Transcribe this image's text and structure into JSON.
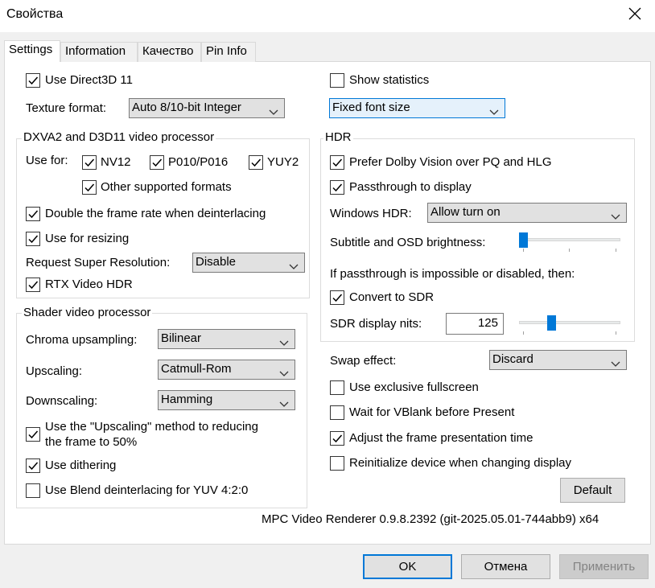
{
  "window": {
    "title": "Свойства"
  },
  "tabs": [
    "Settings",
    "Information",
    "Качество",
    "Pin Info"
  ],
  "left": {
    "use_d3d11": {
      "label": "Use Direct3D 11",
      "checked": true
    },
    "texture_format": {
      "label": "Texture format:",
      "value": "Auto 8/10-bit Integer"
    },
    "dxva_group": {
      "title": "DXVA2 and D3D11 video processor",
      "use_for_label": "Use for:",
      "nv12": {
        "label": "NV12",
        "checked": true
      },
      "p010": {
        "label": "P010/P016",
        "checked": true
      },
      "yuy2": {
        "label": "YUY2",
        "checked": true
      },
      "other": {
        "label": "Other supported formats",
        "checked": true
      },
      "double_rate": {
        "label": "Double the frame rate when deinterlacing",
        "checked": true
      },
      "resizing": {
        "label": "Use for resizing",
        "checked": true
      },
      "super_res_label": "Request Super Resolution:",
      "super_res_value": "Disable",
      "rtx_hdr": {
        "label": "RTX Video HDR",
        "checked": true
      }
    },
    "shader_group": {
      "title": "Shader video processor",
      "chroma_label": "Chroma upsampling:",
      "chroma_value": "Bilinear",
      "upscaling_label": "Upscaling:",
      "upscaling_value": "Catmull-Rom",
      "downscaling_label": "Downscaling:",
      "downscaling_value": "Hamming",
      "upscale_method": {
        "label_line1": "Use the \"Upscaling\" method to reducing",
        "label_line2": "the frame to 50%",
        "checked": true
      },
      "dithering": {
        "label": "Use dithering",
        "checked": true
      },
      "blend": {
        "label": "Use Blend deinterlacing for YUV 4:2:0",
        "checked": false
      }
    }
  },
  "right": {
    "show_stats": {
      "label": "Show statistics",
      "checked": false
    },
    "font_size_value": "Fixed font size",
    "hdr_group": {
      "title": "HDR",
      "dolby": {
        "label": "Prefer Dolby Vision over PQ and HLG",
        "checked": true
      },
      "passthrough": {
        "label": "Passthrough to display",
        "checked": true
      },
      "windows_hdr_label": "Windows HDR:",
      "windows_hdr_value": "Allow turn on",
      "osd_label": "Subtitle and OSD brightness:",
      "osd_level": 0,
      "if_passthrough": "If passthrough is impossible or disabled, then:",
      "convert_sdr": {
        "label": "Convert to SDR",
        "checked": true
      },
      "nits_label": "SDR display nits:",
      "nits_value": "125",
      "nits_level": 0.3
    },
    "swap_label": "Swap effect:",
    "swap_value": "Discard",
    "exclusive": {
      "label": "Use exclusive fullscreen",
      "checked": false
    },
    "vblank": {
      "label": "Wait for VBlank before Present",
      "checked": false
    },
    "adjust_time": {
      "label": "Adjust the frame presentation time",
      "checked": true
    },
    "reinit": {
      "label": "Reinitialize device when changing display",
      "checked": false
    },
    "default_button": "Default"
  },
  "version": "MPC Video Renderer 0.9.8.2392 (git-2025.05.01-744abb9) x64",
  "buttons": {
    "ok": "OK",
    "cancel": "Отмена",
    "apply": "Применить"
  },
  "colors": {
    "accent": "#0078d7",
    "window_bg": "#f0f0f0",
    "panel_bg": "#ffffff"
  }
}
